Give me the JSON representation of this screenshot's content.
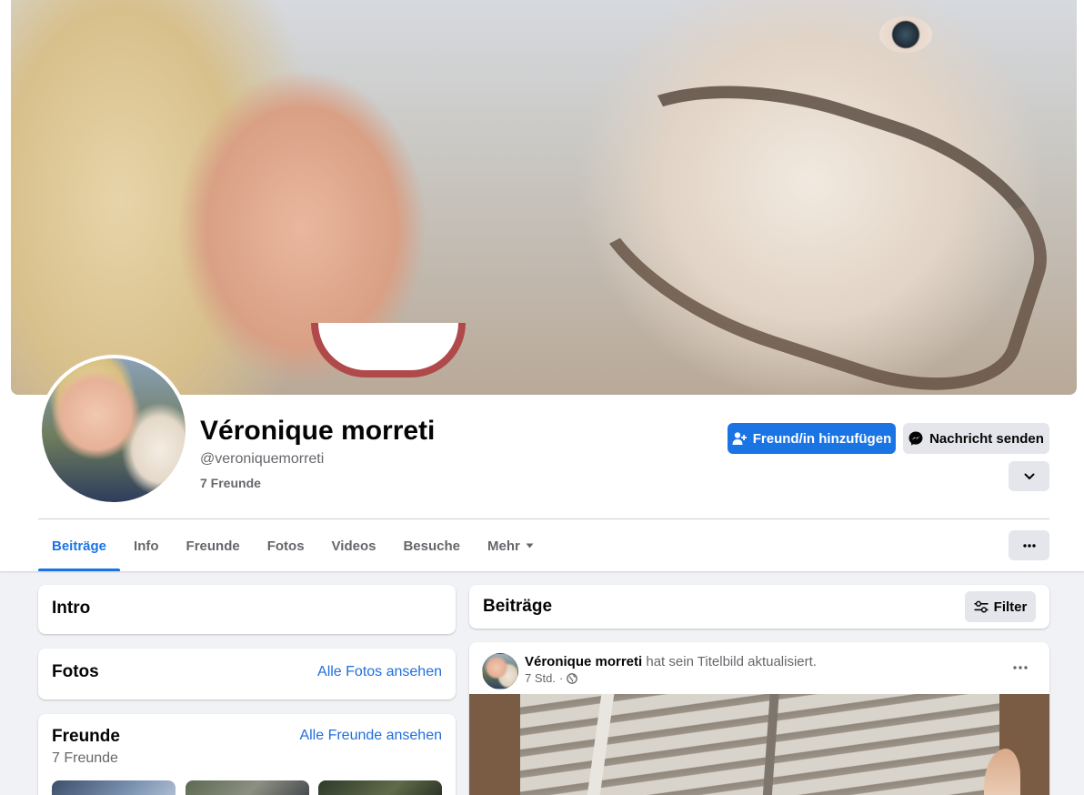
{
  "profile": {
    "name": "Véronique morreti",
    "username": "@veroniquemorreti",
    "friends_count": "7 Freunde"
  },
  "actions": {
    "add_friend": "Freund/in hinzufügen",
    "message": "Nachricht senden"
  },
  "tabs": [
    {
      "label": "Beiträge",
      "active": true
    },
    {
      "label": "Info"
    },
    {
      "label": "Freunde"
    },
    {
      "label": "Fotos"
    },
    {
      "label": "Videos"
    },
    {
      "label": "Besuche"
    },
    {
      "label": "Mehr"
    }
  ],
  "intro": {
    "title": "Intro"
  },
  "photos": {
    "title": "Fotos",
    "link": "Alle Fotos ansehen"
  },
  "friends": {
    "title": "Freunde",
    "link": "Alle Freunde ansehen",
    "count": "7 Freunde"
  },
  "posts": {
    "title": "Beiträge",
    "filter": "Filter",
    "items": [
      {
        "author": "Véronique morreti",
        "action": "hat sein Titelbild aktualisiert.",
        "time": "7 Std.",
        "separator": "·"
      }
    ]
  },
  "colors": {
    "accent": "#1b74e4",
    "secondary_button": "#e4e6eb",
    "text_muted": "#65676b",
    "link": "#216fdb"
  }
}
